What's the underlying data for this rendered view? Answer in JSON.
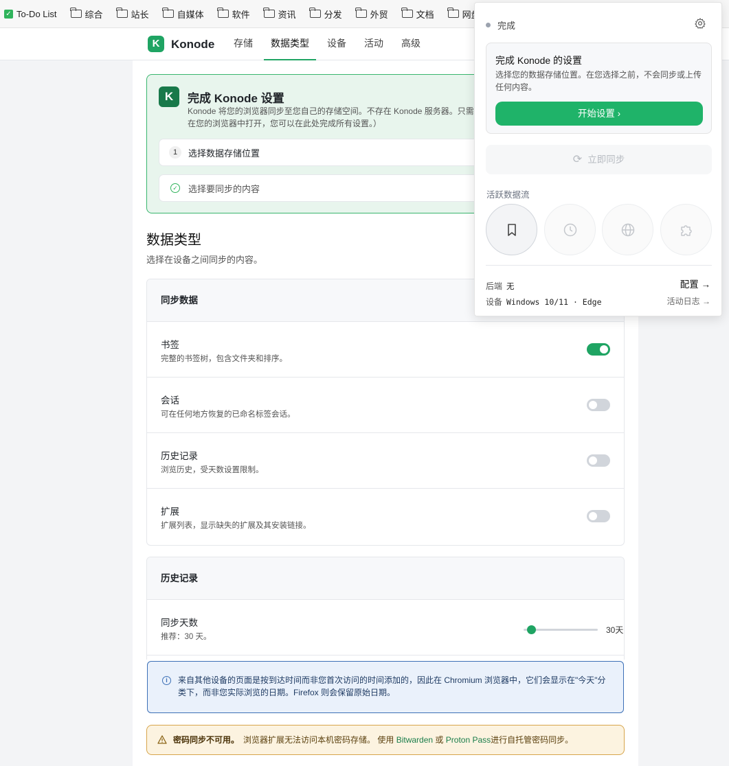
{
  "bookmarks": {
    "first": "To-Do List",
    "folders": [
      "综合",
      "站长",
      "自媒体",
      "软件",
      "资讯",
      "分发",
      "外贸",
      "文档",
      "网盘"
    ]
  },
  "nav": {
    "brand": "Konode",
    "logo_char": "K",
    "tabs": [
      "存储",
      "数据类型",
      "设备",
      "活动",
      "高级"
    ],
    "active_tab": "数据类型"
  },
  "setup": {
    "title": "完成 Konode 设置",
    "desc": "Konode 将您的浏览器同步至您自己的存储空间。不存在 Konode 服务器。只需未在您的浏览器中打开，您可以在此处完成所有设置。）",
    "step1_num": "1",
    "step1_label": "选择数据存储位置",
    "step2_label": "选择要同步的内容"
  },
  "section": {
    "title": "数据类型",
    "subtitle": "选择在设备之间同步的内容。"
  },
  "sync_card": {
    "header": "同步数据",
    "rows": [
      {
        "title": "书签",
        "desc": "完整的书签树，包含文件夹和排序。",
        "on": true
      },
      {
        "title": "会话",
        "desc": "可在任何地方恢复的已命名标签会话。",
        "on": false
      },
      {
        "title": "历史记录",
        "desc": "浏览历史，受天数设置限制。",
        "on": false
      },
      {
        "title": "扩展",
        "desc": "扩展列表，显示缺失的扩展及其安装链接。",
        "on": false
      }
    ]
  },
  "history_card": {
    "header": "历史记录",
    "days_title": "同步天数",
    "days_hint": "推荐：30 天。",
    "days_value": "30天",
    "slider_fraction": 0.1
  },
  "info": {
    "icon": "info-icon",
    "text": "来自其他设备的页面是按到达时间而非您首次访问的时间添加的，因此在 Chromium 浏览器中，它们会显示在\"今天\"分类下，而非您实际浏览的日期。Firefox 则会保留原始日期。"
  },
  "warning": {
    "strong": "密码同步不可用。",
    "text1": "浏览器扩展无法访问本机密码存储。 使用",
    "link1": "Bitwarden",
    "mid": "或",
    "link2": "Proton Pass",
    "text2": "进行自托管密码同步。"
  },
  "popup": {
    "status": "完成",
    "card_title": "完成 Konode 的设置",
    "card_desc": "选择您的数据存储位置。在您选择之前，不会同步或上传任何内容。",
    "start_btn": "开始设置  ›",
    "sync_btn": "立即同步",
    "flow_label": "活跃数据流",
    "backend_label": "后端",
    "backend_value": "无",
    "device_label": "设备",
    "device_value": "Windows 10/11 · Edge",
    "config_link": "配置 →",
    "log_link": "活动日志 →"
  },
  "colors": {
    "accent": "#1fa463",
    "info_border": "#3b6fb6",
    "warn_border": "#d7a44a"
  }
}
